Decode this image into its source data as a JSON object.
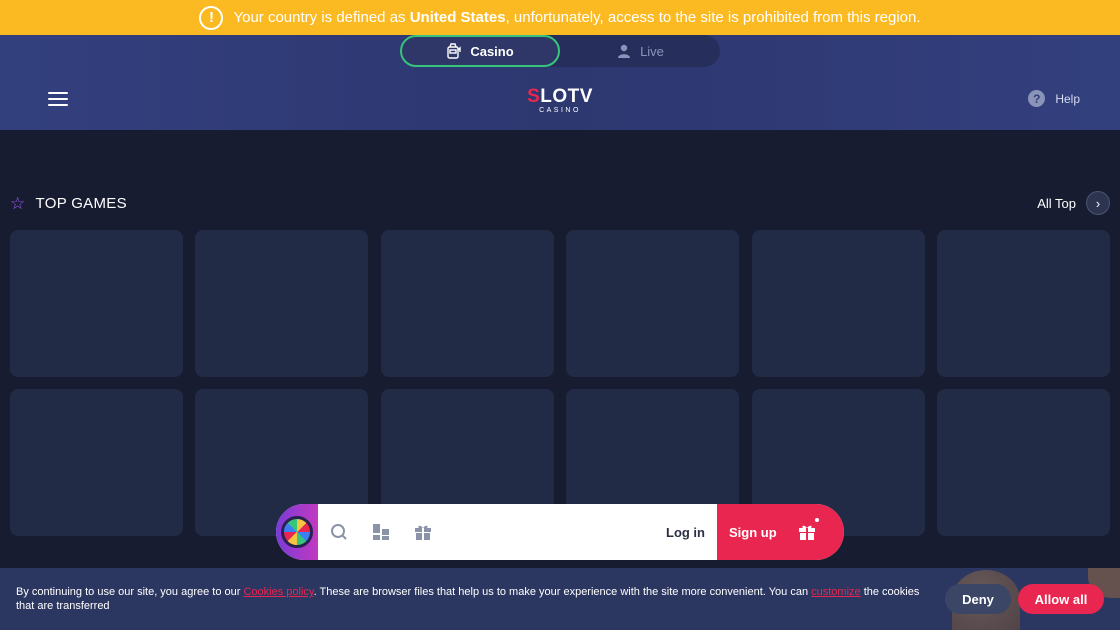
{
  "warning": {
    "prefix": "Your country is defined as ",
    "country": "United States",
    "suffix": ", unfortunately, access to the site is prohibited from this region."
  },
  "mode_switch": {
    "casino_label": "Casino",
    "live_label": "Live",
    "active": "Casino"
  },
  "header": {
    "logo_main": "SLOTV",
    "logo_first_letter": "S",
    "logo_rest": "LOTV",
    "logo_sub": "CASINO",
    "help_label": "Help"
  },
  "top_games": {
    "title": "TOP GAMES",
    "all_label": "All Top",
    "placeholder_count": 12
  },
  "bottom_bar": {
    "login_label": "Log in",
    "signup_label": "Sign up"
  },
  "cookies": {
    "text_1": "By continuing to use our site, you agree to our ",
    "policy_link": "Cookies policy",
    "text_2": ". These are browser files that help us to make your experience with the site more convenient. You can ",
    "customize_link": "customize",
    "text_3": " the cookies that are transferred",
    "deny_label": "Deny",
    "allow_label": "Allow all"
  },
  "colors": {
    "warning_bg": "#fcba22",
    "header_bg": "#33407e",
    "page_bg": "#171c30",
    "card_bg": "#212b46",
    "accent_red": "#e8264f",
    "accent_green": "#37c47c",
    "star_purple": "#a15bf5"
  },
  "icons": {
    "warning": "exclamation-circle-icon",
    "casino": "slot-machine-icon",
    "live": "live-dealer-icon",
    "menu": "hamburger-menu-icon",
    "help": "question-circle-icon",
    "star": "star-outline-icon",
    "arrow": "chevron-right-icon",
    "wheel": "fortune-wheel-icon",
    "search": "search-icon",
    "games": "grid-blocks-icon",
    "gift": "gift-icon"
  }
}
